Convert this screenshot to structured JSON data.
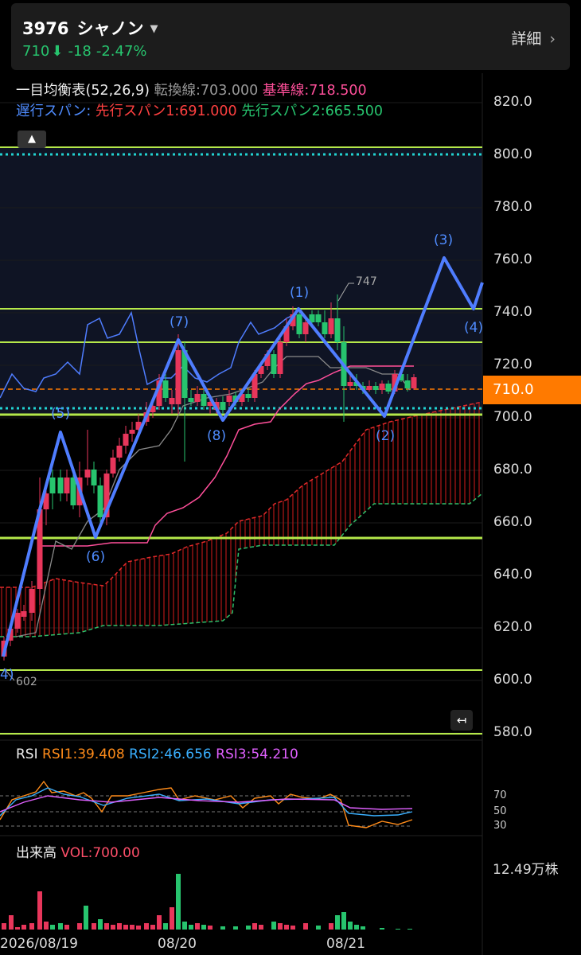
{
  "header": {
    "code": "3976",
    "name": "シャノン",
    "price": "710",
    "arrow": "⬇",
    "change": "-18",
    "change_pct": "-2.47%",
    "detail_label": "詳細",
    "up_color": "#e8365b",
    "down_color": "#27c46e"
  },
  "ichimoku": {
    "title": "一目均衡表(52,26,9)",
    "tenkan": "転換線:703.000",
    "kijun": "基準線:718.500",
    "chikou": "遅行スパン:",
    "senkou1": "先行スパン1:691.000",
    "senkou2": "先行スパン2:665.500"
  },
  "price_axis": [
    "820.0",
    "800.0",
    "780.0",
    "760.0",
    "740.0",
    "720.0",
    "700.0",
    "680.0",
    "660.0",
    "640.0",
    "620.0",
    "600.0",
    "580.0"
  ],
  "current_price_tag": "710.0",
  "annotations": {
    "high": "747",
    "low": "602",
    "waves": [
      "4)",
      "(5)",
      "(6)",
      "(7)",
      "(8)",
      "(1)",
      "(2)",
      "(3)",
      "(4)"
    ]
  },
  "rsi": {
    "title": "RSI",
    "rsi1": "RSI1:39.408",
    "rsi2": "RSI2:46.656",
    "rsi3": "RSI3:54.210",
    "levels": [
      "70",
      "50",
      "30"
    ]
  },
  "volume": {
    "title": "出来高",
    "value": "VOL:700.00",
    "max_label": "12.49万株"
  },
  "time_axis": [
    "2026/08/19",
    "08/20",
    "08/21"
  ],
  "buttons": {
    "up": "▲",
    "back": "↤"
  }
}
